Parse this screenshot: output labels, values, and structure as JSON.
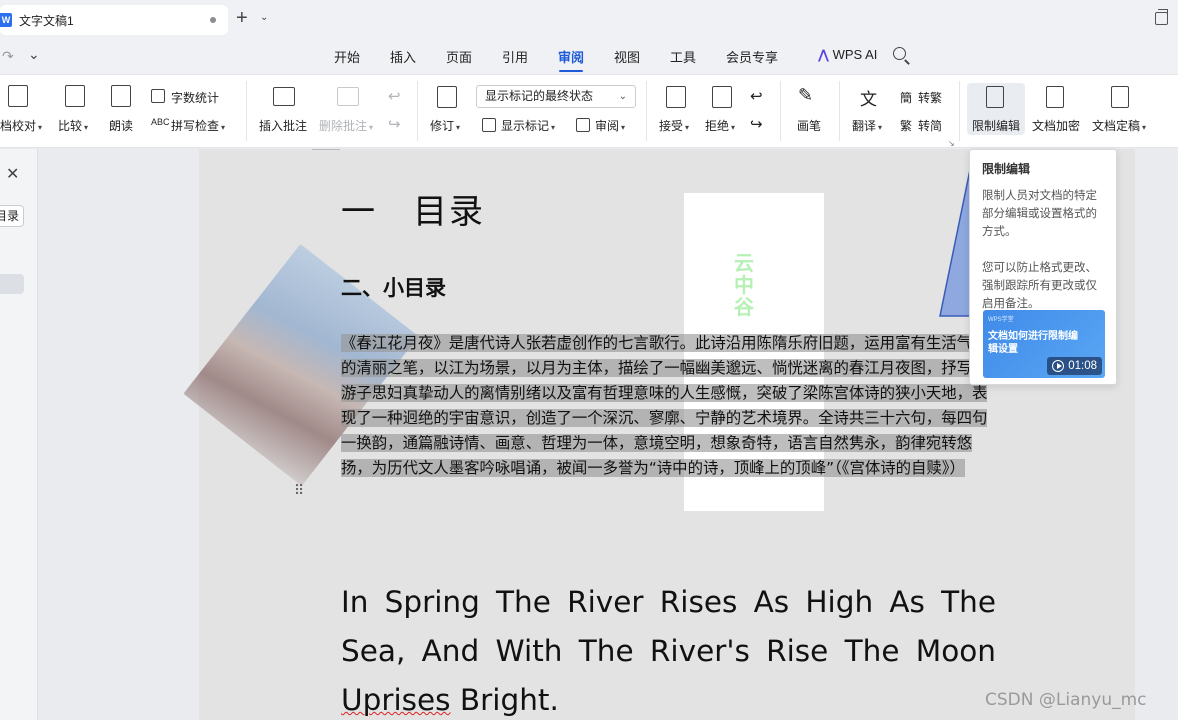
{
  "titlebar": {
    "doc_title": "文字文稿1",
    "app_icon": "W"
  },
  "menu": {
    "items": [
      "开始",
      "插入",
      "页面",
      "引用",
      "审阅",
      "视图",
      "工具",
      "会员专享"
    ],
    "active": "审阅",
    "wps_ai": "WPS AI"
  },
  "ribbon": {
    "doc_check": "档校对",
    "compare": "比较",
    "read_aloud": "朗读",
    "word_count": "字数统计",
    "spell_check": "拼写检查",
    "insert_comment": "插入批注",
    "delete_comment": "删除批注",
    "revise": "修订",
    "display_state": "显示标记的最终状态",
    "show_markup": "显示标记",
    "review": "审阅",
    "accept": "接受",
    "reject": "拒绝",
    "pen": "画笔",
    "translate": "翻译",
    "to_traditional": "转繁",
    "to_simplified": "转简",
    "restrict_edit": "限制编辑",
    "encrypt": "文档加密",
    "finalize": "文档定稿"
  },
  "leftpanel": {
    "toc_label": "目录"
  },
  "document": {
    "heading1": "一　目录",
    "heading2": "二、小目录",
    "image_text": "云中谷",
    "paragraph": "《春江花月夜》是唐代诗人张若虚创作的七言歌行。此诗沿用陈隋乐府旧题，运用富有生活气息的清丽之笔，以江为场景，以月为主体，描绘了一幅幽美邈远、惝恍迷离的春江月夜图，抒写了游子思妇真挚动人的离情别绪以及富有哲理意味的人生感慨，突破了梁陈宫体诗的狭小天地，表现了一种迥绝的宇宙意识，创造了一个深沉、寥廓、宁静的艺术境界。全诗共三十六句，每四句一换韵，通篇融诗情、画意、哲理为一体，意境空明，想象奇特，语言自然隽永，韵律宛转悠扬，为历代文人墨客吟咏唱诵，被闻一多誉为“诗中的诗，顶峰上的顶峰”（《宫体诗的自赎》）",
    "english_1": "In Spring The River Rises As High As The Sea, And With The River's Rise The Moon ",
    "english_misspelled": "Uprises",
    "english_2": " Bright."
  },
  "tooltip": {
    "title": "限制编辑",
    "desc1": "限制人员对文档的特定部分编辑或设置格式的方式。",
    "desc2": "您可以防止格式更改、强制跟踪所有更改或仅启用备注。",
    "video_brand": "WPS学堂",
    "video_title": "文档如何进行限制编辑设置",
    "video_duration": "01:08"
  },
  "watermark": "CSDN @Lianyu_mc",
  "colors": {
    "accent": "#1f5bd8",
    "ai": "#5a3fe0",
    "highlight": "#9a9a9a"
  }
}
